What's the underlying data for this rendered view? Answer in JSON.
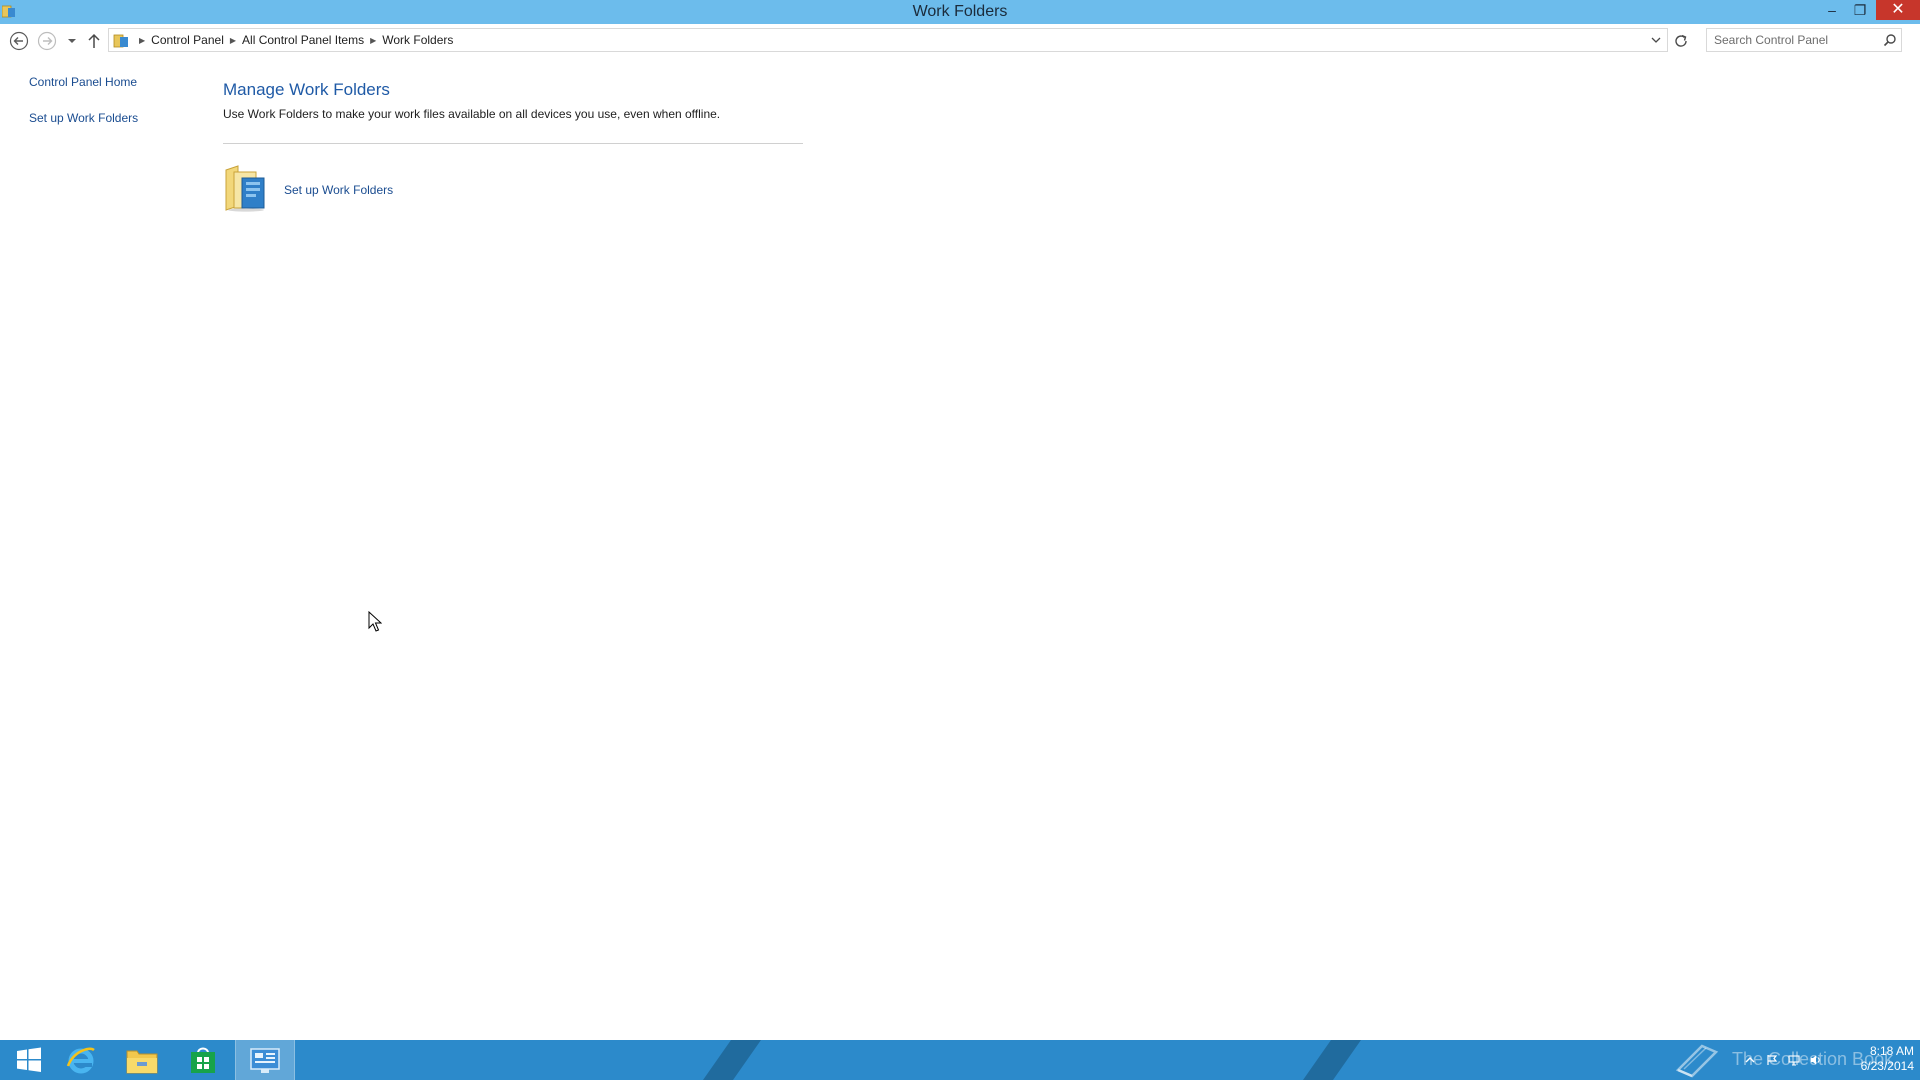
{
  "window": {
    "title": "Work Folders",
    "minimize_label": "–",
    "maximize_label": "❐",
    "close_label": "✕"
  },
  "navbar": {
    "breadcrumbs": [
      "Control Panel",
      "All Control Panel Items",
      "Work Folders"
    ],
    "search_placeholder": "Search Control Panel"
  },
  "sidebar": {
    "items": [
      {
        "label": "Control Panel Home"
      },
      {
        "label": "Set up Work Folders"
      }
    ]
  },
  "main": {
    "title": "Manage Work Folders",
    "description": "Use Work Folders to make your work files available on all devices you use, even when offline.",
    "setup_link": "Set up Work Folders"
  },
  "taskbar": {
    "apps": [
      {
        "name": "Start",
        "icon": "windows-logo-icon",
        "active": false
      },
      {
        "name": "Internet Explorer",
        "icon": "internet-explorer-icon",
        "active": false
      },
      {
        "name": "File Explorer",
        "icon": "file-explorer-icon",
        "active": false
      },
      {
        "name": "Store",
        "icon": "store-icon",
        "active": false
      },
      {
        "name": "Control Panel",
        "icon": "control-panel-icon",
        "active": true
      }
    ],
    "watermark": "The Collection Book",
    "clock": {
      "time": "8:18 AM",
      "date": "6/23/2014"
    }
  },
  "colors": {
    "titlebar": "#6cbcec",
    "taskbar": "#2c8acb",
    "link": "#1a4c90",
    "heading": "#1f5aa6",
    "close": "#c7362b"
  }
}
